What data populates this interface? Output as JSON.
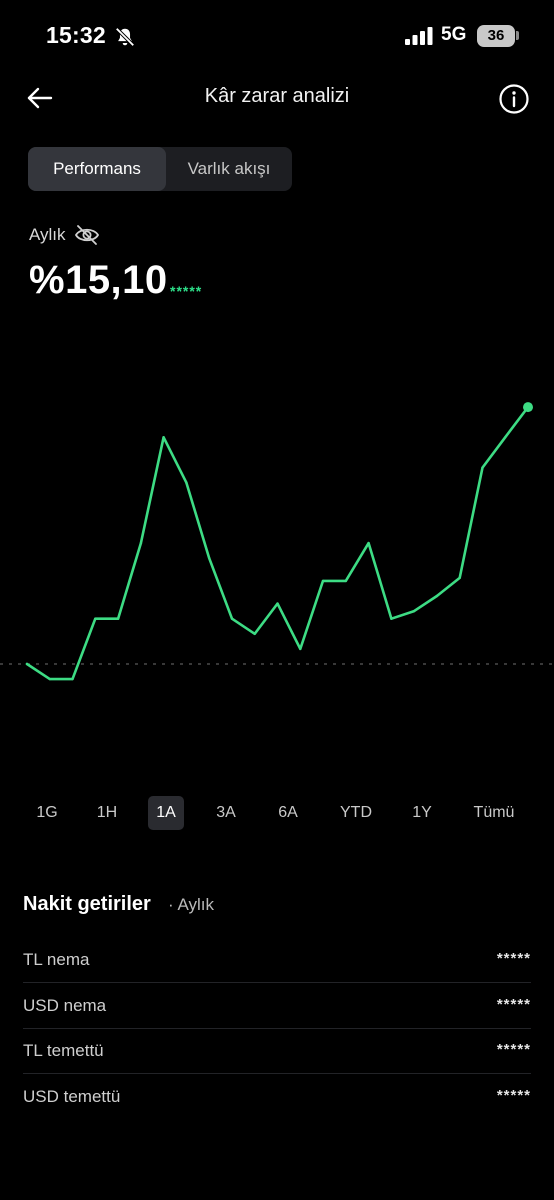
{
  "status_bar": {
    "time": "15:32",
    "network": "5G",
    "battery": "36"
  },
  "header": {
    "title": "Kâr zarar analizi"
  },
  "tabs": [
    {
      "label": "Performans",
      "active": true
    },
    {
      "label": "Varlık akışı",
      "active": false
    }
  ],
  "summary": {
    "period": "Aylık",
    "value": "%15,10",
    "masked_amount": "*****"
  },
  "chart_data": {
    "type": "line",
    "title": "",
    "xlabel": "",
    "ylabel": "",
    "color": "#3ddc84",
    "baseline_value": 0,
    "ylim": [
      -4.5,
      18
    ],
    "series": [
      {
        "name": "",
        "values": [
          0.0,
          -1.0,
          -1.0,
          3.0,
          3.0,
          8.0,
          15.0,
          12.0,
          7.0,
          3.0,
          2.0,
          4.0,
          1.0,
          5.5,
          5.5,
          8.0,
          3.0,
          3.5,
          4.5,
          5.7,
          13.0,
          15.0,
          17.0
        ]
      }
    ]
  },
  "ranges": [
    {
      "label": "1G",
      "active": false
    },
    {
      "label": "1H",
      "active": false
    },
    {
      "label": "1A",
      "active": true
    },
    {
      "label": "3A",
      "active": false
    },
    {
      "label": "6A",
      "active": false
    },
    {
      "label": "YTD",
      "active": false
    },
    {
      "label": "1Y",
      "active": false
    },
    {
      "label": "Tümü",
      "active": false
    }
  ],
  "cash_returns": {
    "title": "Nakit getiriler",
    "period": "· Aylık",
    "items": [
      {
        "label": "TL nema",
        "value": "*****"
      },
      {
        "label": "USD nema",
        "value": "*****"
      },
      {
        "label": "TL temettü",
        "value": "*****"
      },
      {
        "label": "USD temettü",
        "value": "*****"
      }
    ]
  },
  "colors": {
    "accent_green": "#3ddc84",
    "background": "#000000",
    "tab_active_bg": "#34363c"
  }
}
